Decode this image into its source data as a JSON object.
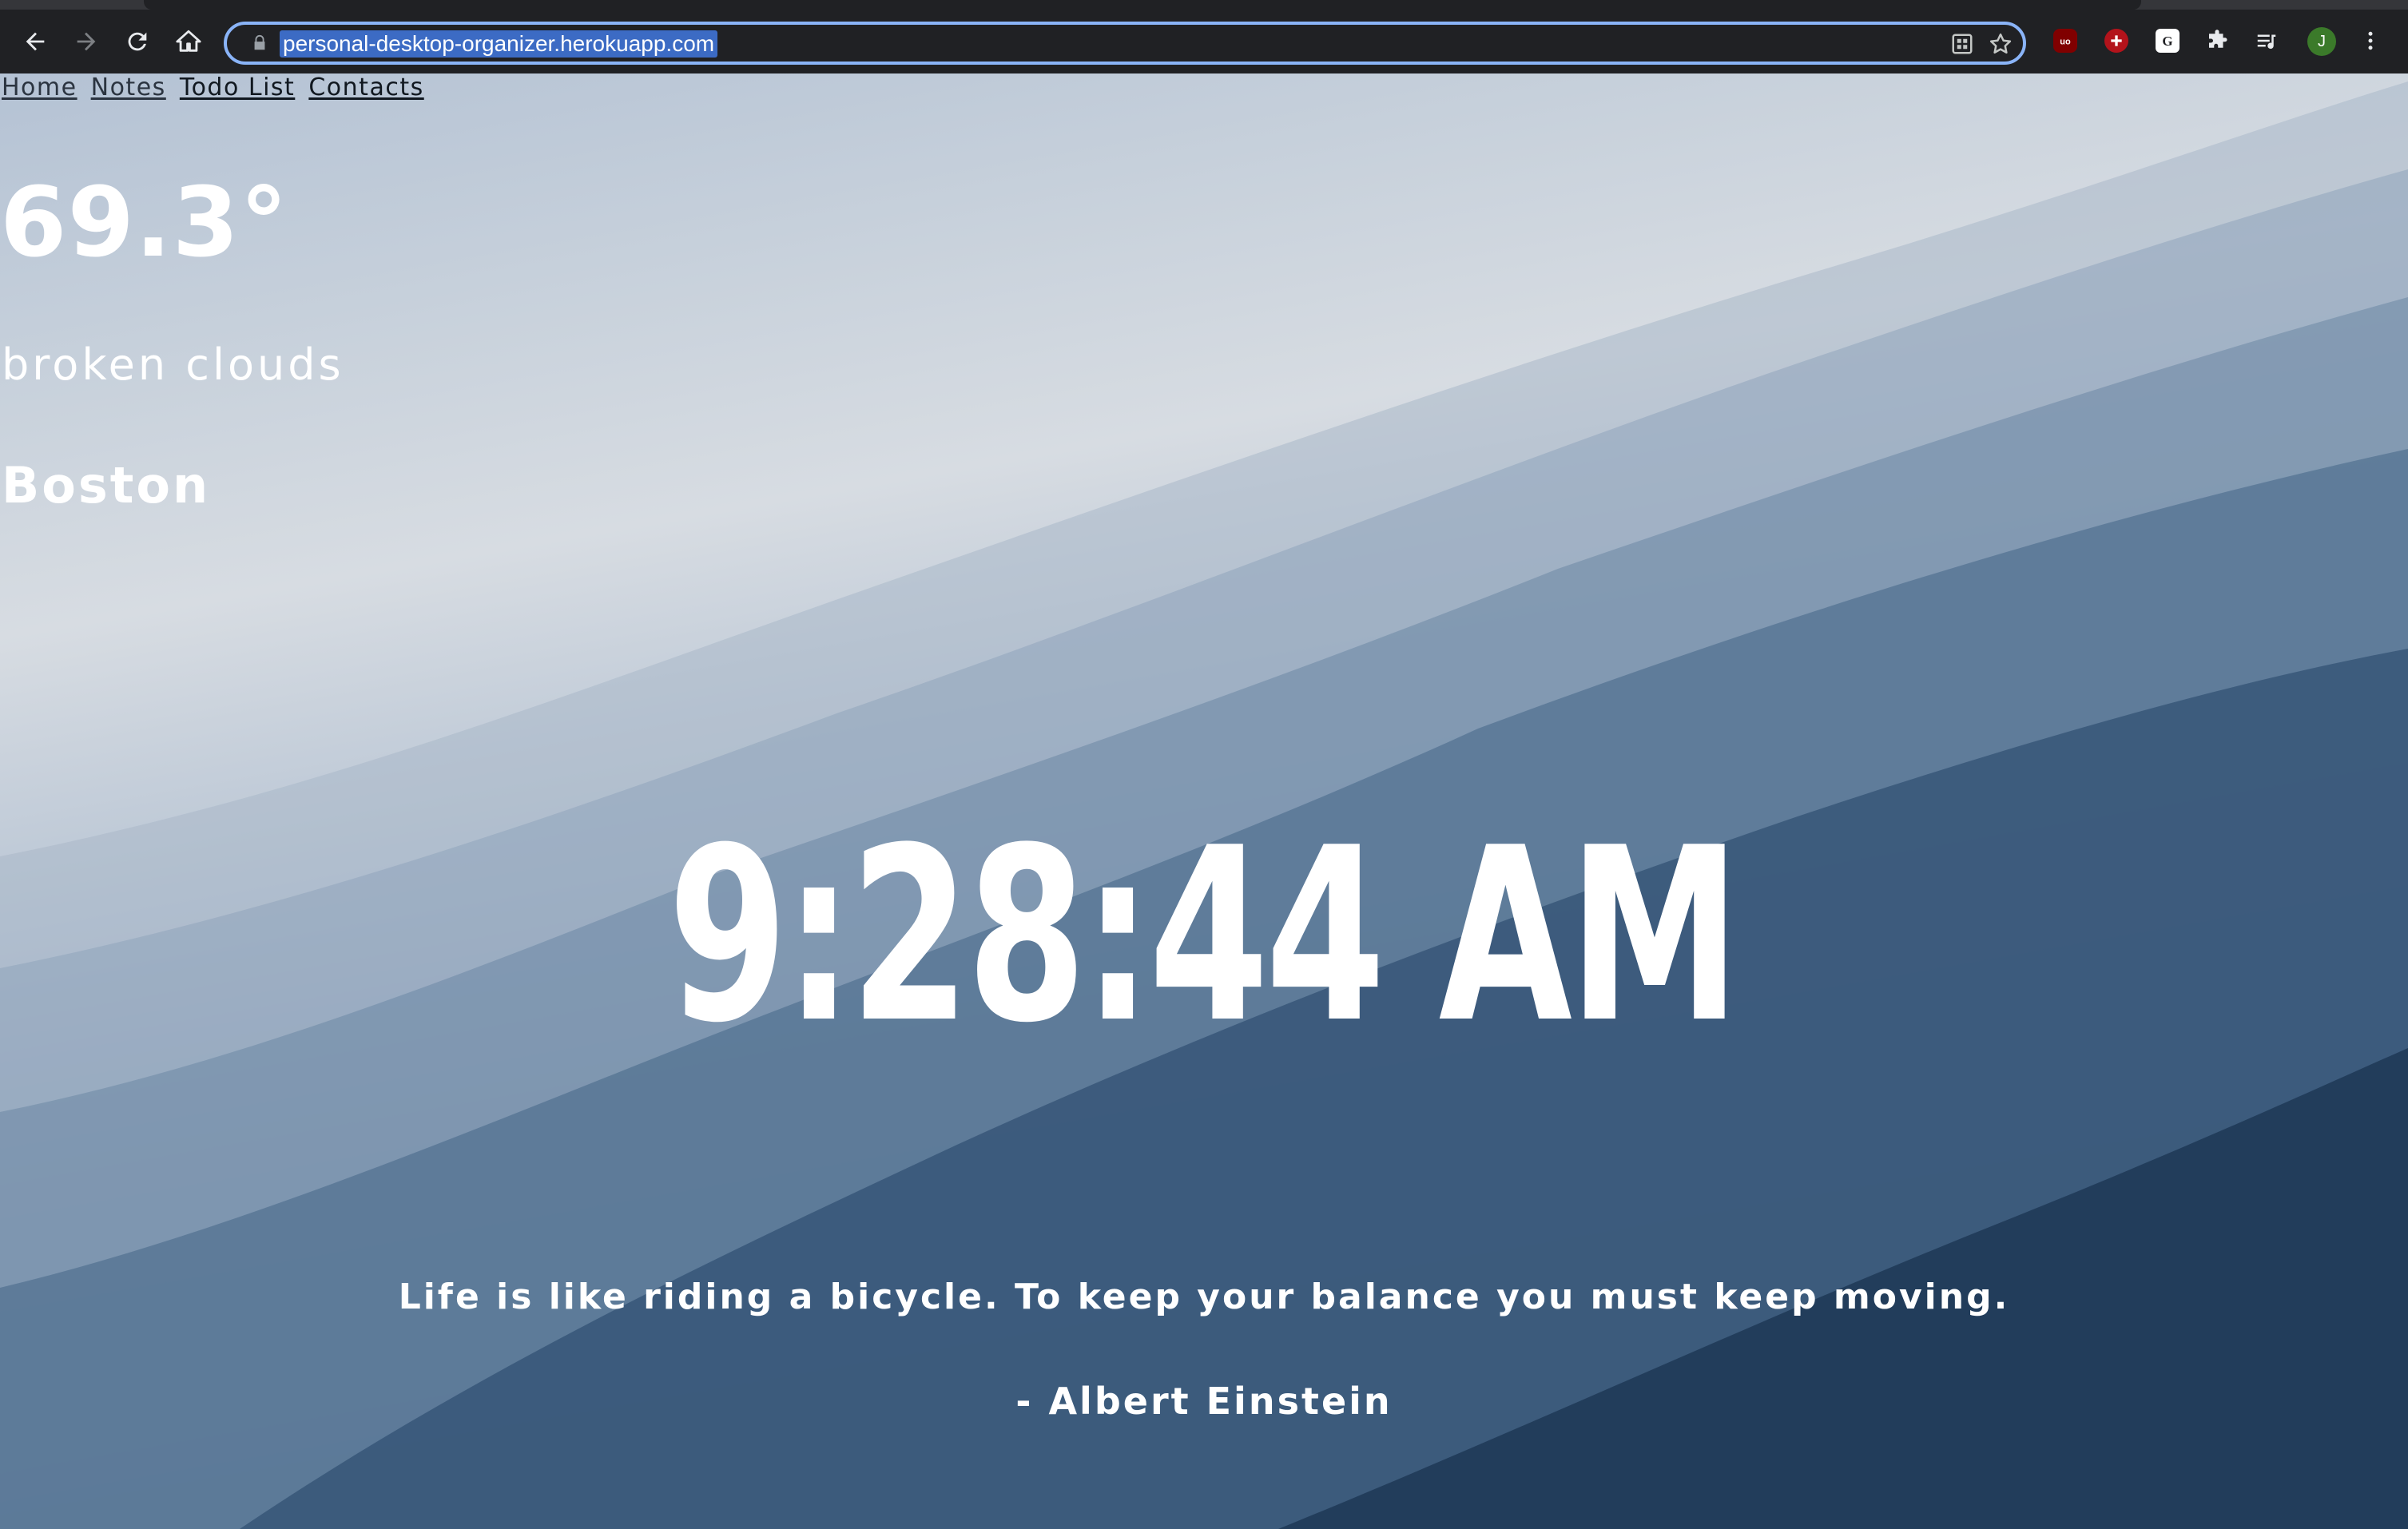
{
  "browser": {
    "url": "personal-desktop-organizer.herokuapp.com",
    "profile_initial": "J"
  },
  "nav": {
    "home": "Home",
    "notes": "Notes",
    "todo": "Todo List",
    "contacts": "Contacts"
  },
  "weather": {
    "temperature": "69.3°",
    "description": "broken clouds",
    "city": "Boston"
  },
  "clock": {
    "time": "9:28:44 AM"
  },
  "quote": {
    "text": "Life is like riding a bicycle. To keep your balance you must keep moving.",
    "author": "- Albert Einstein"
  },
  "icons": {
    "back": "arrow-left-icon",
    "forward": "arrow-right-icon",
    "reload": "reload-icon",
    "home": "home-icon",
    "lock": "lock-icon",
    "install": "install-app-icon",
    "bookmark": "star-icon",
    "ublock": "ublock-icon",
    "ext_red": "red-cross-extension-icon",
    "grammarly": "g-extension-icon",
    "extensions": "puzzle-icon",
    "reading_list": "reading-list-icon",
    "menu": "kebab-menu-icon"
  },
  "colors": {
    "chrome_bg": "#202124",
    "omnibox_border": "#8ab4f8",
    "url_highlight": "#3c6bc4",
    "avatar": "#3b7a2a",
    "text_on_page": "#ffffff"
  }
}
